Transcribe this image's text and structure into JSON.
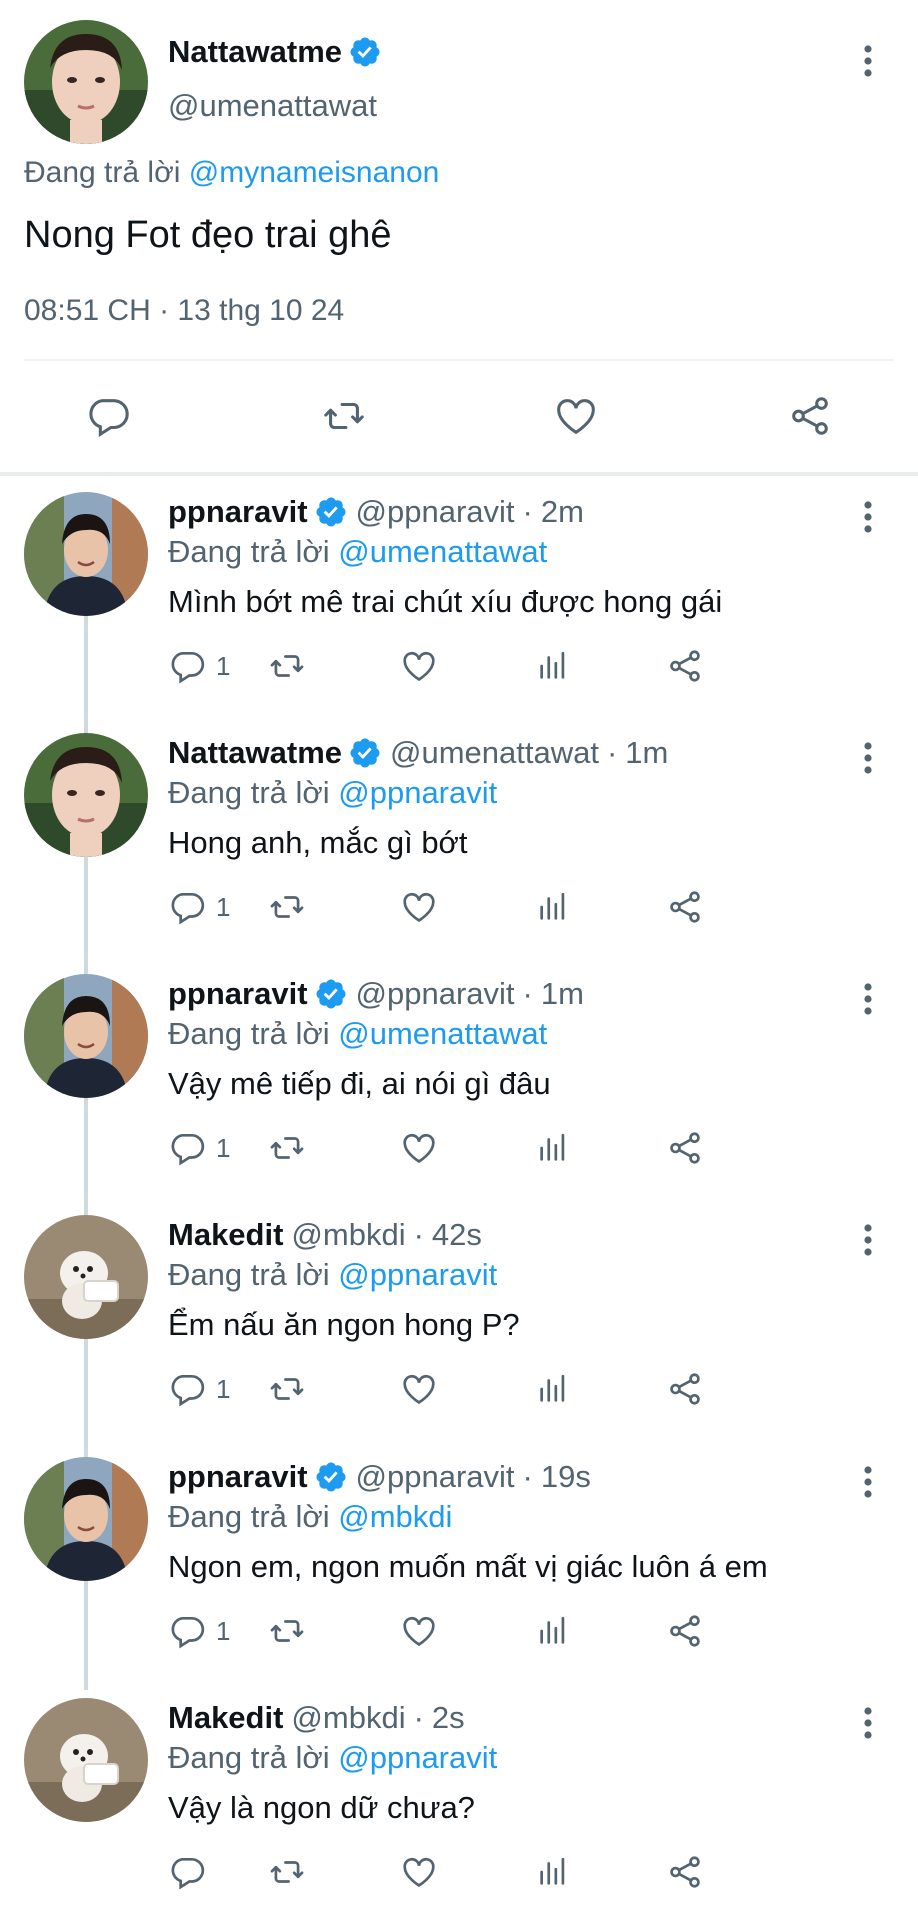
{
  "main_tweet": {
    "author_name": "Nattawatme",
    "author_handle": "@umenattawat",
    "reply_prefix": "Đang trả lời",
    "reply_mention": "@mynameisnanon",
    "text": "Nong Fot đẹo trai ghê",
    "timestamp": "08:51 CH · 13 thg 10 24",
    "icons": [
      "reply-icon",
      "retweet-icon",
      "like-icon",
      "share-icon"
    ]
  },
  "replies": [
    {
      "name": "ppnaravit",
      "verified": true,
      "handle": "@ppnaravit",
      "dot": "·",
      "ago": "2m",
      "reply_prefix": "Đang trả lời",
      "mention": "@umenattawat",
      "text": "Mình bớt mê trai chút xíu được hong gái",
      "reply_count": "1",
      "avatar": "ppnaravit"
    },
    {
      "name": "Nattawatme",
      "verified": true,
      "handle": "@umenattawat",
      "dot": "·",
      "ago": "1m",
      "reply_prefix": "Đang trả lời",
      "mention": "@ppnaravit",
      "text": "Hong anh, mắc gì bớt",
      "reply_count": "1",
      "avatar": "nattawat"
    },
    {
      "name": "ppnaravit",
      "verified": true,
      "handle": "@ppnaravit",
      "dot": "·",
      "ago": "1m",
      "reply_prefix": "Đang trả lời",
      "mention": "@umenattawat",
      "text": "Vậy mê tiếp đi, ai nói gì đâu",
      "reply_count": "1",
      "avatar": "ppnaravit"
    },
    {
      "name": "Makedit",
      "verified": false,
      "handle": "@mbkdi",
      "dot": "·",
      "ago": "42s",
      "reply_prefix": "Đang trả lời",
      "mention": "@ppnaravit",
      "text": "Ểm nấu ăn ngon hong P?",
      "reply_count": "1",
      "avatar": "makedit"
    },
    {
      "name": "ppnaravit",
      "verified": true,
      "handle": "@ppnaravit",
      "dot": "·",
      "ago": "19s",
      "reply_prefix": "Đang trả lời",
      "mention": "@mbkdi",
      "text": "Ngon em, ngon muốn mất vị giác luôn á em",
      "reply_count": "1",
      "avatar": "ppnaravit"
    },
    {
      "name": "Makedit",
      "verified": false,
      "handle": "@mbkdi",
      "dot": "·",
      "ago": "2s",
      "reply_prefix": "Đang trả lời",
      "mention": "@ppnaravit",
      "text": "Vậy là ngon dữ chưa?",
      "reply_count": "",
      "avatar": "makedit"
    }
  ],
  "colors": {
    "link_blue": "#1d9bf0",
    "verified_blue": "#1d9bf0",
    "secondary_text": "#536471",
    "primary_text": "#0f1419"
  }
}
